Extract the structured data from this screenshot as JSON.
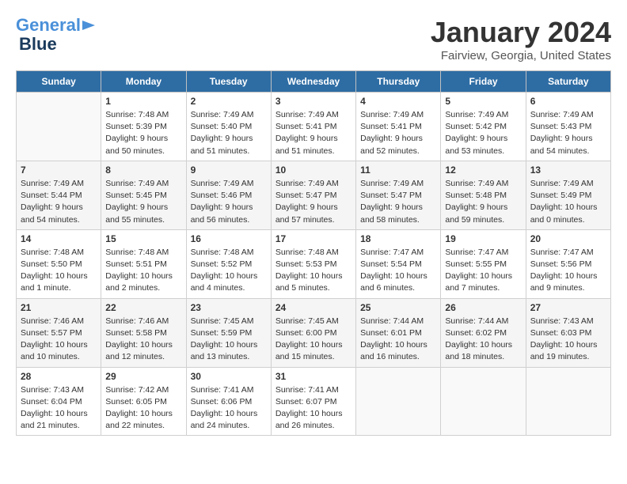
{
  "header": {
    "logo_line1": "General",
    "logo_line2": "Blue",
    "month_title": "January 2024",
    "location": "Fairview, Georgia, United States"
  },
  "days_of_week": [
    "Sunday",
    "Monday",
    "Tuesday",
    "Wednesday",
    "Thursday",
    "Friday",
    "Saturday"
  ],
  "weeks": [
    [
      {
        "day": "",
        "info": ""
      },
      {
        "day": "1",
        "info": "Sunrise: 7:48 AM\nSunset: 5:39 PM\nDaylight: 9 hours\nand 50 minutes."
      },
      {
        "day": "2",
        "info": "Sunrise: 7:49 AM\nSunset: 5:40 PM\nDaylight: 9 hours\nand 51 minutes."
      },
      {
        "day": "3",
        "info": "Sunrise: 7:49 AM\nSunset: 5:41 PM\nDaylight: 9 hours\nand 51 minutes."
      },
      {
        "day": "4",
        "info": "Sunrise: 7:49 AM\nSunset: 5:41 PM\nDaylight: 9 hours\nand 52 minutes."
      },
      {
        "day": "5",
        "info": "Sunrise: 7:49 AM\nSunset: 5:42 PM\nDaylight: 9 hours\nand 53 minutes."
      },
      {
        "day": "6",
        "info": "Sunrise: 7:49 AM\nSunset: 5:43 PM\nDaylight: 9 hours\nand 54 minutes."
      }
    ],
    [
      {
        "day": "7",
        "info": "Sunrise: 7:49 AM\nSunset: 5:44 PM\nDaylight: 9 hours\nand 54 minutes."
      },
      {
        "day": "8",
        "info": "Sunrise: 7:49 AM\nSunset: 5:45 PM\nDaylight: 9 hours\nand 55 minutes."
      },
      {
        "day": "9",
        "info": "Sunrise: 7:49 AM\nSunset: 5:46 PM\nDaylight: 9 hours\nand 56 minutes."
      },
      {
        "day": "10",
        "info": "Sunrise: 7:49 AM\nSunset: 5:47 PM\nDaylight: 9 hours\nand 57 minutes."
      },
      {
        "day": "11",
        "info": "Sunrise: 7:49 AM\nSunset: 5:47 PM\nDaylight: 9 hours\nand 58 minutes."
      },
      {
        "day": "12",
        "info": "Sunrise: 7:49 AM\nSunset: 5:48 PM\nDaylight: 9 hours\nand 59 minutes."
      },
      {
        "day": "13",
        "info": "Sunrise: 7:49 AM\nSunset: 5:49 PM\nDaylight: 10 hours\nand 0 minutes."
      }
    ],
    [
      {
        "day": "14",
        "info": "Sunrise: 7:48 AM\nSunset: 5:50 PM\nDaylight: 10 hours\nand 1 minute."
      },
      {
        "day": "15",
        "info": "Sunrise: 7:48 AM\nSunset: 5:51 PM\nDaylight: 10 hours\nand 2 minutes."
      },
      {
        "day": "16",
        "info": "Sunrise: 7:48 AM\nSunset: 5:52 PM\nDaylight: 10 hours\nand 4 minutes."
      },
      {
        "day": "17",
        "info": "Sunrise: 7:48 AM\nSunset: 5:53 PM\nDaylight: 10 hours\nand 5 minutes."
      },
      {
        "day": "18",
        "info": "Sunrise: 7:47 AM\nSunset: 5:54 PM\nDaylight: 10 hours\nand 6 minutes."
      },
      {
        "day": "19",
        "info": "Sunrise: 7:47 AM\nSunset: 5:55 PM\nDaylight: 10 hours\nand 7 minutes."
      },
      {
        "day": "20",
        "info": "Sunrise: 7:47 AM\nSunset: 5:56 PM\nDaylight: 10 hours\nand 9 minutes."
      }
    ],
    [
      {
        "day": "21",
        "info": "Sunrise: 7:46 AM\nSunset: 5:57 PM\nDaylight: 10 hours\nand 10 minutes."
      },
      {
        "day": "22",
        "info": "Sunrise: 7:46 AM\nSunset: 5:58 PM\nDaylight: 10 hours\nand 12 minutes."
      },
      {
        "day": "23",
        "info": "Sunrise: 7:45 AM\nSunset: 5:59 PM\nDaylight: 10 hours\nand 13 minutes."
      },
      {
        "day": "24",
        "info": "Sunrise: 7:45 AM\nSunset: 6:00 PM\nDaylight: 10 hours\nand 15 minutes."
      },
      {
        "day": "25",
        "info": "Sunrise: 7:44 AM\nSunset: 6:01 PM\nDaylight: 10 hours\nand 16 minutes."
      },
      {
        "day": "26",
        "info": "Sunrise: 7:44 AM\nSunset: 6:02 PM\nDaylight: 10 hours\nand 18 minutes."
      },
      {
        "day": "27",
        "info": "Sunrise: 7:43 AM\nSunset: 6:03 PM\nDaylight: 10 hours\nand 19 minutes."
      }
    ],
    [
      {
        "day": "28",
        "info": "Sunrise: 7:43 AM\nSunset: 6:04 PM\nDaylight: 10 hours\nand 21 minutes."
      },
      {
        "day": "29",
        "info": "Sunrise: 7:42 AM\nSunset: 6:05 PM\nDaylight: 10 hours\nand 22 minutes."
      },
      {
        "day": "30",
        "info": "Sunrise: 7:41 AM\nSunset: 6:06 PM\nDaylight: 10 hours\nand 24 minutes."
      },
      {
        "day": "31",
        "info": "Sunrise: 7:41 AM\nSunset: 6:07 PM\nDaylight: 10 hours\nand 26 minutes."
      },
      {
        "day": "",
        "info": ""
      },
      {
        "day": "",
        "info": ""
      },
      {
        "day": "",
        "info": ""
      }
    ]
  ]
}
